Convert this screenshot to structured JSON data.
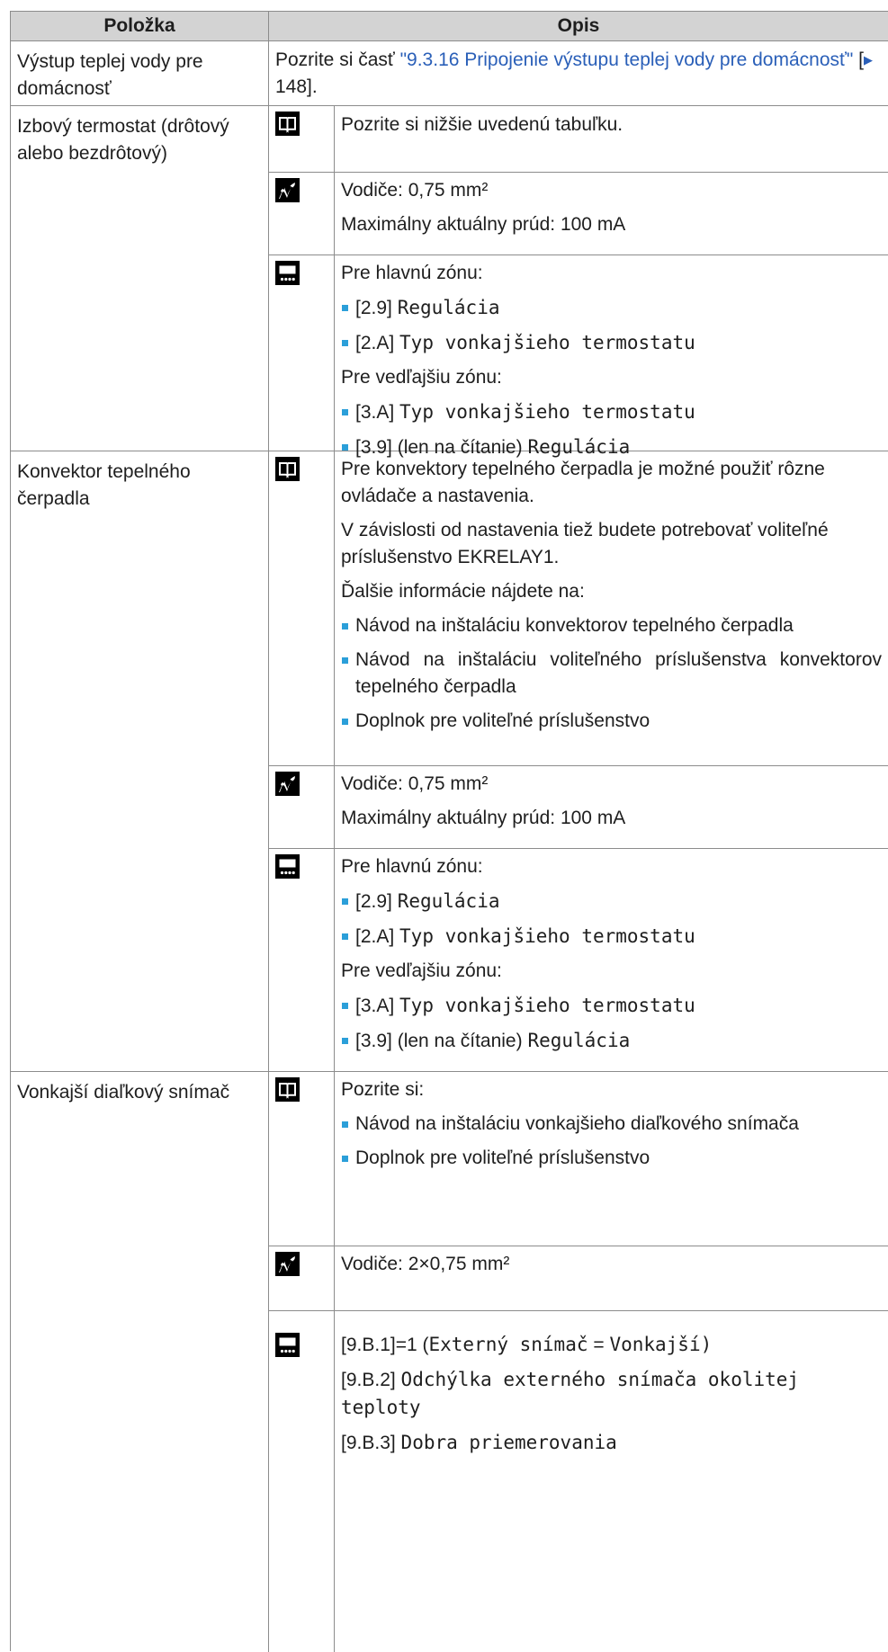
{
  "header": {
    "col_item": "Položka",
    "col_desc": "Opis"
  },
  "row1": {
    "item": "Výstup teplej vody pre domácnosť",
    "desc_prefix": "Pozrite si časť ",
    "desc_link": "\"9.3.16 Pripojenie výstupu teplej vody pre domácnosť\"",
    "desc_ref_open": " [",
    "desc_ref_arrow": "▶",
    "desc_ref_page": " 148",
    "desc_ref_close": "]."
  },
  "row2": {
    "item": "Izbový termostat (drôtový alebo bezdrôtový)",
    "book": "Pozrite si nižšie uvedenú tabuľku.",
    "wire1": "Vodiče: 0,75 mm²",
    "wire2": "Maximálny aktuálny prúd: 100 mA",
    "main_zone": "Pre hlavnú zónu:",
    "b1_code": "[2.9] ",
    "b1_label": "Regulácia",
    "b2_code": "[2.A] ",
    "b2_label": "Typ vonkajšieho termostatu",
    "aux_zone": "Pre vedľajšiu zónu:",
    "b3_code": "[3.A] ",
    "b3_label": "Typ vonkajšieho termostatu",
    "b4_code": "[3.9] (len na čítanie) ",
    "b4_label": "Regulácia"
  },
  "row3": {
    "item": "Konvektor tepelného čerpadla",
    "p1": "Pre konvektory tepelného čerpadla je možné použiť rôzne ovládače a nastavenia.",
    "p2": "V závislosti od nastavenia tiež budete potrebovať voliteľné príslušenstvo EKRELAY1.",
    "p3": "Ďalšie informácie nájdete na:",
    "li1": "Návod na inštaláciu konvektorov tepelného čerpadla",
    "li2": "Návod na inštaláciu voliteľného príslušenstva konvektorov tepelného čerpadla",
    "li3": "Doplnok pre voliteľné príslušenstvo",
    "wire1": "Vodiče: 0,75 mm²",
    "wire2": "Maximálny aktuálny prúd: 100 mA",
    "main_zone": "Pre hlavnú zónu:",
    "b1_code": "[2.9] ",
    "b1_label": "Regulácia",
    "b2_code": "[2.A] ",
    "b2_label": "Typ vonkajšieho termostatu",
    "aux_zone": "Pre vedľajšiu zónu:",
    "b3_code": "[3.A] ",
    "b3_label": "Typ vonkajšieho termostatu",
    "b4_code": "[3.9] (len na čítanie) ",
    "b4_label": "Regulácia"
  },
  "row4": {
    "item": "Vonkajší diaľkový snímač",
    "p1": "Pozrite si:",
    "li1": "Návod na inštaláciu vonkajšieho diaľkového snímača",
    "li2": "Doplnok pre voliteľné príslušenstvo",
    "wire": "Vodiče: 2×0,75 mm²",
    "s1_code": "[9.B.1]=1 (",
    "s1_label": "Externý snímač",
    "s1_eq": " = ",
    "s1_value": "Vonkajší",
    "s1_close": ")",
    "s2_code": "[9.B.2] ",
    "s2_label": "Odchýlka externého snímača okolitej teploty",
    "s3_code": "[9.B.3] ",
    "s3_label": "Dobra priemerovania"
  },
  "icons": {
    "book": "book-icon",
    "wire": "wire-icon",
    "ui": "user-interface-icon",
    "arrow": "right-arrow-icon"
  },
  "colors": {
    "header_bg": "#d3d3d3",
    "link": "#2a5fb8",
    "bullet": "#2b9fd9",
    "border": "#8c8c8c"
  }
}
